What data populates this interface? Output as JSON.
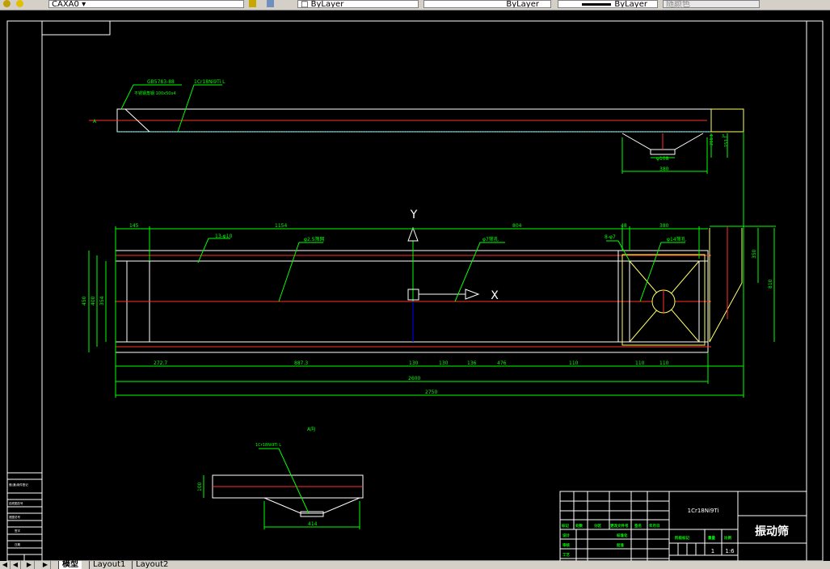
{
  "toolbar": {
    "layer_name": "CAXA0",
    "color": "ByLayer",
    "linetype": "ByLayer",
    "lineweight": "ByLayer",
    "plot_style": "随颜色"
  },
  "drawing": {
    "top_view": {
      "label_a": "A",
      "leader1": "GB5783-88",
      "leader1b": "不锈钢角钢 100x50x4",
      "leader2": "1Cr18Ni9Ti L",
      "dim_outlet_width": "φ108",
      "dim_hopper_width": "380",
      "dim_h1": "211.1",
      "dim_h2": "153.1",
      "dim_h3": "3"
    },
    "plan_view": {
      "axis_y": "Y",
      "axis_x": "X",
      "dims_top": [
        "145",
        "1154",
        "804",
        "48",
        "380"
      ],
      "leaders": [
        "13-φ10",
        "φ2.5筛网",
        "φ7筛孔",
        "8-φ7",
        "φ14筛孔"
      ],
      "dims_bottom": [
        "272.7",
        "887.3",
        "130",
        "130",
        "136",
        "476",
        "110",
        "110",
        "110"
      ],
      "dim_total_inner": "2600",
      "dim_total": "2750",
      "dims_left": [
        "450",
        "400",
        "354"
      ],
      "dims_right": [
        "350",
        "810"
      ]
    },
    "section_view": {
      "title": "A向",
      "leader": "1Cr18Ni9Ti L",
      "dim_height": "100",
      "dim_width": "414"
    },
    "title_block": {
      "material": "1Cr18Ni9Ti",
      "part_name": "振动筛",
      "headers": [
        "标记",
        "处数",
        "分区",
        "更改文件号",
        "签名",
        "年月日"
      ],
      "row_labels": [
        "设计",
        "审核",
        "工艺"
      ],
      "mid_labels": [
        "标准化",
        "批准"
      ],
      "stage_label": "阶段标记",
      "weight_label": "重量",
      "scale_label": "比例",
      "weight": "1",
      "scale": "1:6"
    },
    "side_block": [
      "借(通)用件登记",
      "旧底图总号",
      "底图总号",
      "签字",
      "日期"
    ]
  },
  "tabs": {
    "model": "模型",
    "layout1": "Layout1",
    "layout2": "Layout2"
  },
  "colors": {
    "green": "#00ff00",
    "white": "#ffffff",
    "red": "#ff0000",
    "yellow": "#ffff66",
    "cyan": "#80ffff",
    "blue": "#0000ff"
  }
}
